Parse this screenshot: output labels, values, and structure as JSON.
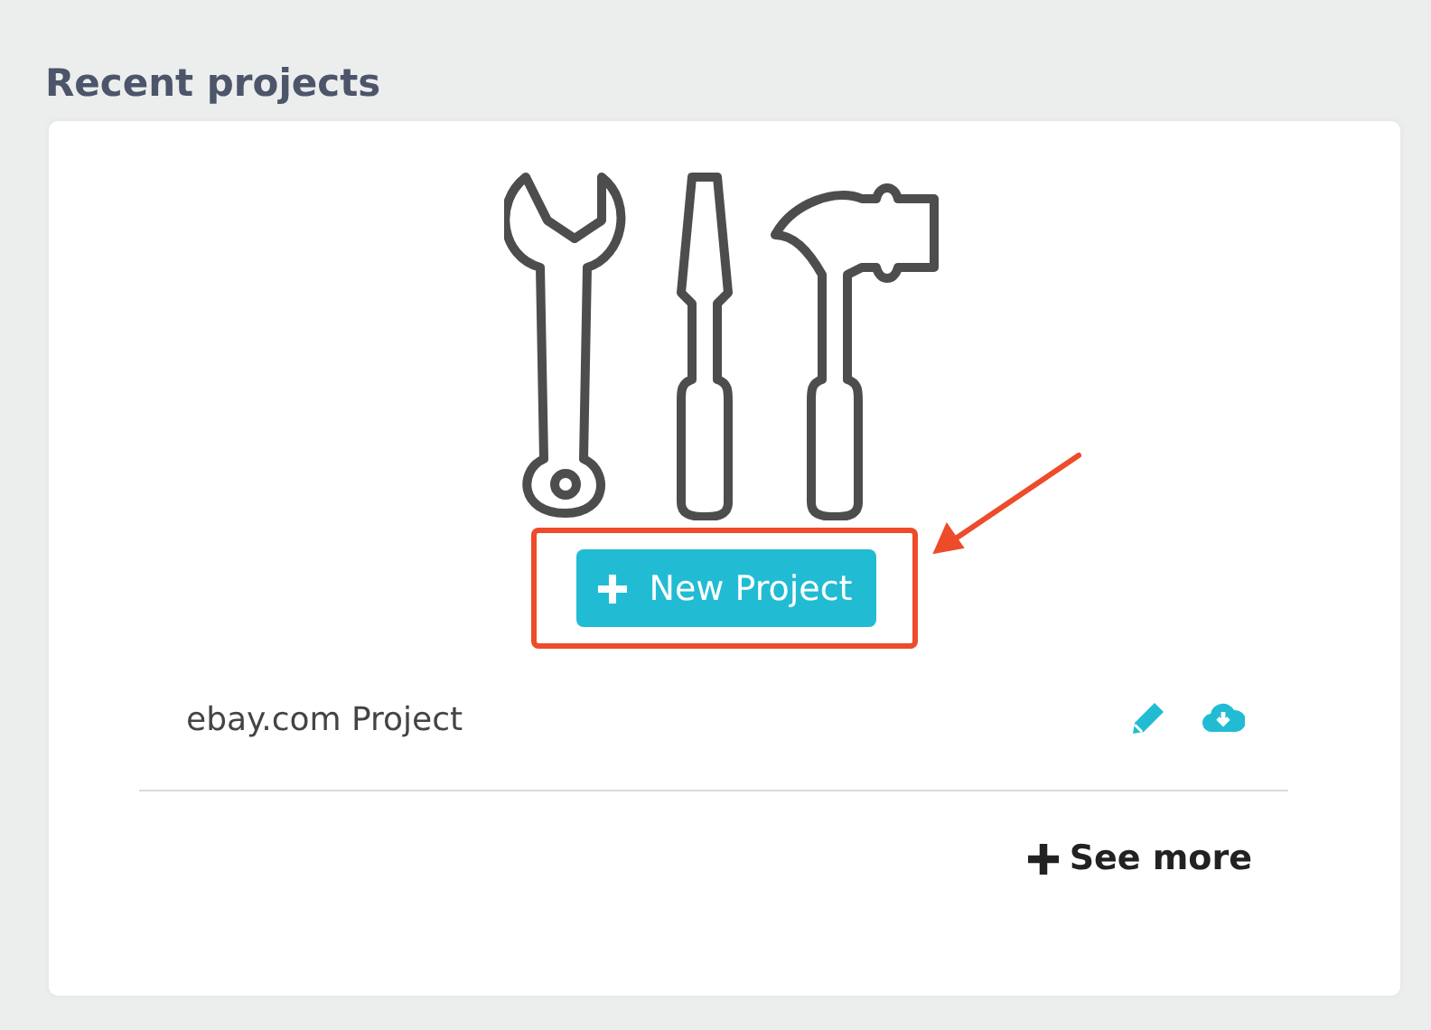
{
  "section_title": "Recent projects",
  "new_project_button": {
    "label": "New Project",
    "highlighted": true
  },
  "projects": [
    {
      "name": "ebay.com Project"
    }
  ],
  "see_more": "See more"
}
